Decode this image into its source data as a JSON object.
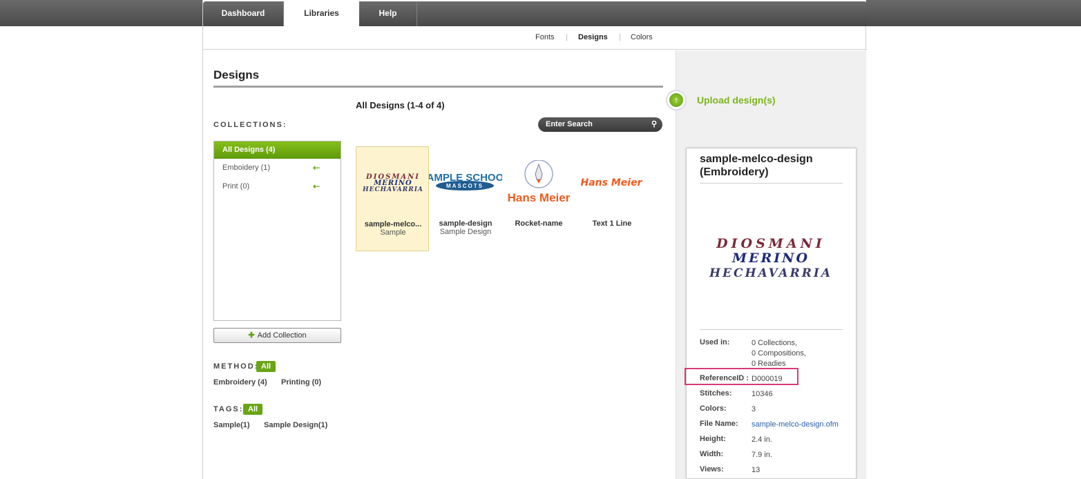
{
  "tabs": [
    {
      "label": "Dashboard",
      "active": false
    },
    {
      "label": "Libraries",
      "active": true
    },
    {
      "label": "Help",
      "active": false
    }
  ],
  "subnav": {
    "items": [
      "Fonts",
      "Designs",
      "Colors"
    ],
    "separator": "|",
    "active": "Designs"
  },
  "page": {
    "title": "Designs"
  },
  "collections": {
    "label": "COLLECTIONS:",
    "active": "All Designs (4)",
    "items": [
      "Emboidery (1)",
      "Print (0)"
    ],
    "add_button": "Add Collection"
  },
  "method": {
    "label": "METHOD:",
    "pill": "All",
    "items": [
      "Embroidery (4)",
      "Printing (0)"
    ]
  },
  "tags": {
    "label": "TAGS:",
    "pill": "All",
    "items": [
      "Sample(1)",
      "Sample Design(1)"
    ]
  },
  "grid": {
    "title": "All Designs (1-4 of 4)",
    "search_placeholder": "Enter Search",
    "cards": [
      {
        "name": "sample-melco...",
        "sub": "Sample",
        "selected": true,
        "art": {
          "line1": "DIOSMANI",
          "line2": "MERINO",
          "line3": "HECHAVARRIA"
        }
      },
      {
        "name": "sample-design",
        "sub": "Sample Design",
        "selected": false,
        "art": {
          "line1": "SAMPLE SCHOOL",
          "line2": "MASCOTS"
        }
      },
      {
        "name": "Rocket-name",
        "sub": "",
        "selected": false,
        "art": {
          "line1": "Hans Meier"
        }
      },
      {
        "name": "Text 1 Line",
        "sub": "",
        "selected": false,
        "art": {
          "line1": "Hans Meier"
        }
      }
    ]
  },
  "upload": {
    "label": "Upload design(s)"
  },
  "detail": {
    "title": "sample-melco-design (Embroidery)",
    "art": {
      "line1": "DIOSMANI",
      "line2": "MERINO",
      "line3": "HECHAVARRIA"
    },
    "rows": [
      {
        "key": "Used in:",
        "value": "0 Collections,\n0 Compositions,\n0 Readies"
      },
      {
        "key": "ReferenceID :",
        "value": "D000019"
      },
      {
        "key": "Stitches:",
        "value": "10346"
      },
      {
        "key": "Colors:",
        "value": "3"
      },
      {
        "key": "File Name:",
        "value": "sample-melco-design.ofm"
      },
      {
        "key": "Height:",
        "value": "2.4 in."
      },
      {
        "key": "Width:",
        "value": "7.9 in."
      },
      {
        "key": "Views:",
        "value": "13"
      }
    ]
  },
  "colors": {
    "accent_green": "#6aa514",
    "link_blue": "#2c5fa8",
    "highlight": "#d83a78",
    "selected_card": "#fdf4cf"
  }
}
